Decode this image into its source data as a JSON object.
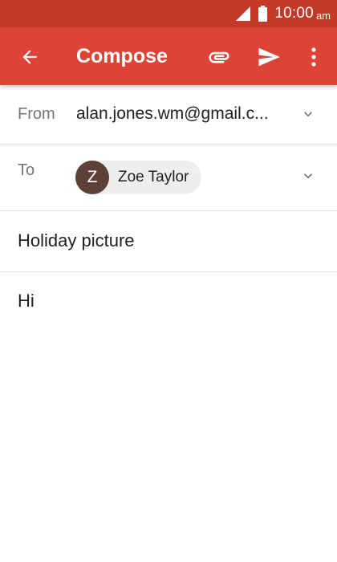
{
  "status_bar": {
    "time": "10:00",
    "ampm": "am"
  },
  "app_bar": {
    "title": "Compose",
    "color": "#db4437",
    "status_color": "#c53929",
    "icons": [
      "back-arrow-icon",
      "attachment-icon",
      "send-icon",
      "more-vert-icon"
    ]
  },
  "from": {
    "label": "From",
    "value": "alan.jones.wm@gmail.c..."
  },
  "to": {
    "label": "To",
    "recipient": {
      "initial": "Z",
      "name": "Zoe Taylor",
      "avatar_color": "#5d4037"
    }
  },
  "subject": {
    "value": "Holiday picture"
  },
  "message_body": {
    "value": "Hi"
  }
}
